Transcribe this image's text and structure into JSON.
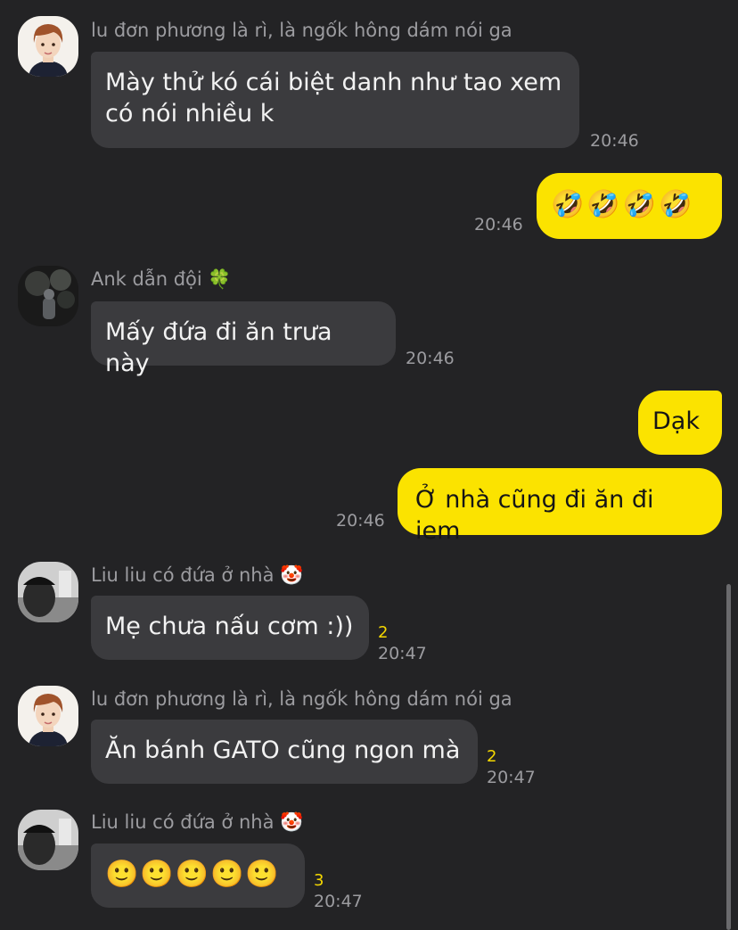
{
  "messages": [
    {
      "sender": "lu đơn phương là rì, là ngốk hông dám nói ga",
      "text": "Mày thử kó cái biệt danh như tao xem\ncó nói nhiều k",
      "time": "20:46"
    },
    {
      "text": "🤣🤣🤣🤣",
      "time": "20:46"
    },
    {
      "sender": "Ank dẫn đội 🍀",
      "text": "Mấy đứa đi ăn trưa này",
      "time": "20:46"
    },
    {
      "text": "Dạk"
    },
    {
      "text": "Ở nhà cũng đi ăn đi iem",
      "time": "20:46"
    },
    {
      "sender": "Liu liu có đứa ở nhà 🤡",
      "text": "Mẹ chưa nấu cơm :))",
      "unread": "2",
      "time": "20:47"
    },
    {
      "sender": "lu đơn phương là rì, là ngốk hông dám nói ga",
      "text": "Ăn bánh GATO cũng ngon mà",
      "unread": "2",
      "time": "20:47"
    },
    {
      "sender": "Liu liu có đứa ở nhà 🤡",
      "text": "🙂🙂🙂🙂🙂",
      "unread": "3",
      "time": "20:47"
    }
  ],
  "icons": {
    "avatar_1": "boy-portrait-avatar",
    "avatar_2": "dark-photo-avatar",
    "avatar_3": "grayscale-photo-avatar"
  },
  "colors": {
    "background": "#232325",
    "incoming_bubble": "#3b3b3e",
    "outgoing_bubble": "#fbe300",
    "unread_count": "#f5d800"
  }
}
